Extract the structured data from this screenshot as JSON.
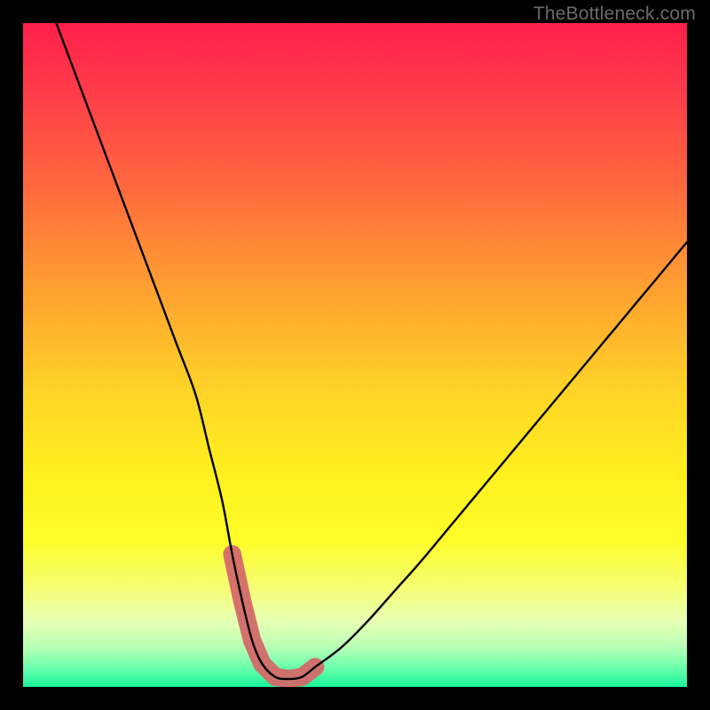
{
  "watermark": "TheBottleneck.com",
  "colors": {
    "frame": "#000000",
    "gradient_stops": [
      {
        "offset": 0.0,
        "color": "#ff1f4b"
      },
      {
        "offset": 0.1,
        "color": "#ff3b4a"
      },
      {
        "offset": 0.25,
        "color": "#ff6a3d"
      },
      {
        "offset": 0.4,
        "color": "#ffa031"
      },
      {
        "offset": 0.55,
        "color": "#ffd227"
      },
      {
        "offset": 0.68,
        "color": "#fff01f"
      },
      {
        "offset": 0.78,
        "color": "#fdfd2a"
      },
      {
        "offset": 0.85,
        "color": "#f6ff73"
      },
      {
        "offset": 0.9,
        "color": "#e7ffb3"
      },
      {
        "offset": 0.94,
        "color": "#b8ffb6"
      },
      {
        "offset": 0.97,
        "color": "#6dffad"
      },
      {
        "offset": 1.0,
        "color": "#19f39b"
      }
    ],
    "curve": "#000000",
    "marker": "#d46a6a"
  },
  "chart_data": {
    "type": "line",
    "title": "",
    "xlabel": "",
    "ylabel": "",
    "xlim": [
      0,
      100
    ],
    "ylim": [
      0,
      100
    ],
    "grid": false,
    "legend": false,
    "series": [
      {
        "name": "bottleneck-curve",
        "x": [
          5,
          8,
          11,
          14,
          17,
          20,
          23,
          26,
          28,
          30,
          31.5,
          33,
          34.5,
          36,
          38,
          40,
          42,
          44,
          48,
          52,
          56,
          60,
          65,
          70,
          75,
          80,
          85,
          90,
          95,
          100
        ],
        "y": [
          100,
          92,
          84,
          76,
          68,
          60,
          52,
          44,
          36,
          28,
          20,
          13,
          7,
          3.5,
          1.5,
          1.2,
          1.5,
          3,
          6,
          10,
          14.5,
          19,
          25,
          31,
          37,
          43,
          49,
          55,
          61,
          67
        ]
      }
    ],
    "markers": {
      "name": "highlight-near-minimum",
      "x": [
        31.5,
        33,
        34.5,
        36,
        38,
        40,
        42,
        44
      ],
      "y": [
        20,
        13,
        7,
        3.5,
        1.5,
        1.2,
        1.5,
        3
      ],
      "radius": 3.2
    }
  }
}
